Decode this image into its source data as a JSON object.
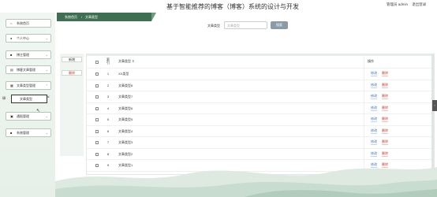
{
  "app_title": "基于智能推荐的博客（博客）系统的设计与开发",
  "top_right": {
    "admin_label": "管理员 admin",
    "logout_label": "退出登录"
  },
  "sidebar": {
    "items": [
      {
        "label": "系统首页",
        "icon": "home-icon"
      },
      {
        "label": "个人中心",
        "icon": "user-icon"
      },
      {
        "label": "博主管理",
        "icon": "blogger-icon"
      },
      {
        "label": "博客文章管理",
        "icon": "article-icon"
      },
      {
        "label": "文章类型管理",
        "icon": "category-icon"
      },
      {
        "label": "通报管理",
        "icon": "notice-icon"
      },
      {
        "label": "系统管理",
        "icon": "settings-icon"
      }
    ],
    "submenu": {
      "label": "文章类型"
    }
  },
  "breadcrumb": {
    "home": "系统首页",
    "separator": "/",
    "current": "文章类型"
  },
  "search": {
    "label": "文章类型",
    "placeholder": "文章类型",
    "button": "搜索"
  },
  "actions": {
    "add": "新增",
    "delete": "删除"
  },
  "table": {
    "headers": {
      "index": "索引",
      "name": "文章类型",
      "sort_icon": "⇕",
      "operation": "操作"
    },
    "rows": [
      {
        "index": "1",
        "name": "XX类型"
      },
      {
        "index": "2",
        "name": "文章类型8"
      },
      {
        "index": "3",
        "name": "文章类型7"
      },
      {
        "index": "4",
        "name": "文章类型6"
      },
      {
        "index": "5",
        "name": "文章类型5"
      },
      {
        "index": "6",
        "name": "文章类型4"
      },
      {
        "index": "7",
        "name": "文章类型3"
      },
      {
        "index": "8",
        "name": "文章类型2"
      },
      {
        "index": "9",
        "name": "文章类型1"
      }
    ],
    "edit_label": "修改",
    "delete_label": "删除"
  },
  "colors": {
    "accent": "#3f6e53",
    "sidebar_bg": "#e6f0e8",
    "edit": "#3d73b8",
    "delete": "#c0392b"
  }
}
